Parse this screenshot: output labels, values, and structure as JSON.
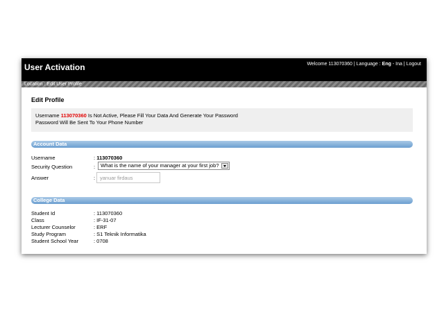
{
  "header": {
    "title": "User Activation",
    "welcome_text": "Welcome 113070360",
    "sep1": " | ",
    "language_label": "Language : ",
    "lang_eng": "Eng",
    "lang_dash": " - ",
    "lang_ina": "Ina",
    "sep2": " | ",
    "logout": "Logout"
  },
  "location": {
    "text": "Location : Edit User Profile"
  },
  "page_title": "Edit Profile",
  "notice": {
    "prefix": "Username ",
    "username": "113070360",
    "line1_rest": " Is Not Active, Please Fill Your Data And Generate Your Password",
    "line2": "Password Will Be Sent To Your Phone Number"
  },
  "account_section": {
    "title": "Account Data",
    "username_label": "Username",
    "username_value": "113070360",
    "security_label": "Security Question",
    "security_value": "What is the name of your manager at your first job?",
    "answer_label": "Answer",
    "answer_value": "yanuar firdaus",
    "colon": ":"
  },
  "college_section": {
    "title": "College Data",
    "rows": [
      {
        "label": "Student Id",
        "value": ": 113070360"
      },
      {
        "label": "Class",
        "value": ": IF-31-07"
      },
      {
        "label": "Lecturer Counselor",
        "value": ": ERF"
      },
      {
        "label": "Study Program",
        "value": ": S1 Teknik Informatika"
      },
      {
        "label": "Student School Year",
        "value": ": 0708"
      }
    ]
  },
  "colors": {
    "header_bg": "#000000",
    "section_bar": "#6c9fd0",
    "highlight_red": "#e20000",
    "notice_bg": "#efefef"
  }
}
